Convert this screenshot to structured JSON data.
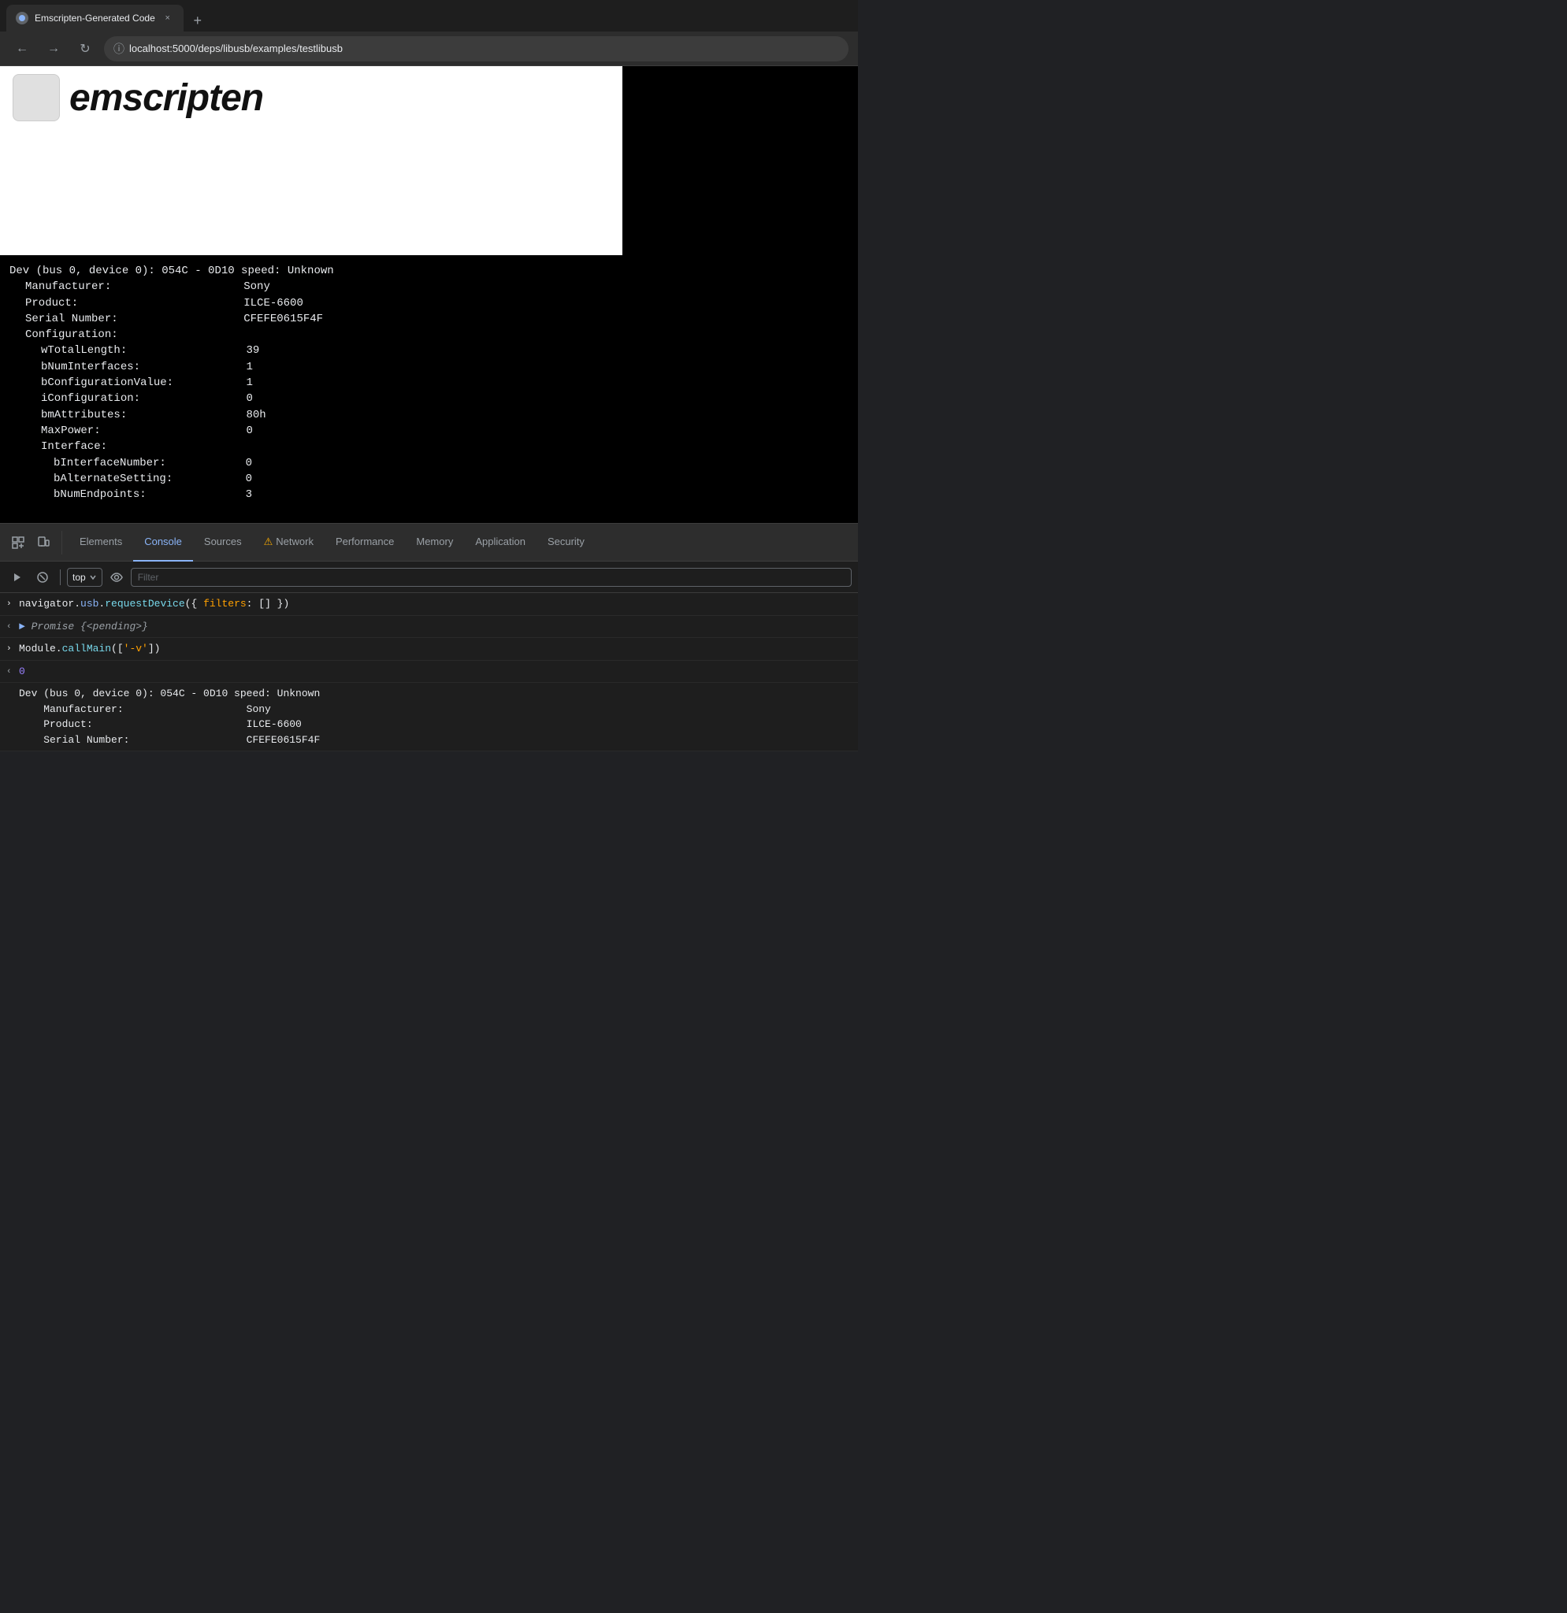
{
  "browser": {
    "tab_title": "Emscripten-Generated Code",
    "new_tab_label": "+",
    "close_label": "×",
    "url": "localhost:5000/deps/libusb/examples/testlibusb",
    "back_label": "←",
    "forward_label": "→",
    "reload_label": "↻"
  },
  "page": {
    "logo_text": "emscripten"
  },
  "terminal": {
    "lines": [
      "Dev (bus 0, device 0): 054C - 0D10 speed: Unknown",
      "  Manufacturer:                    Sony",
      "  Product:                         ILCE-6600",
      "  Serial Number:                   CFEFE0615F4F",
      "  Configuration:",
      "    wTotalLength:                  39",
      "    bNumInterfaces:                1",
      "    bConfigurationValue:           1",
      "    iConfiguration:                0",
      "    bmAttributes:                  80h",
      "    MaxPower:                      0",
      "    Interface:",
      "      bInterfaceNumber:            0",
      "      bAlternateSetting:           0",
      "      bNumEndpoints:               3"
    ]
  },
  "devtools": {
    "tabs": [
      {
        "id": "elements",
        "label": "Elements",
        "active": false,
        "warning": false
      },
      {
        "id": "console",
        "label": "Console",
        "active": true,
        "warning": false
      },
      {
        "id": "sources",
        "label": "Sources",
        "active": false,
        "warning": false
      },
      {
        "id": "network",
        "label": "Network",
        "active": false,
        "warning": true
      },
      {
        "id": "performance",
        "label": "Performance",
        "active": false,
        "warning": false
      },
      {
        "id": "memory",
        "label": "Memory",
        "active": false,
        "warning": false
      },
      {
        "id": "application",
        "label": "Application",
        "active": false,
        "warning": false
      },
      {
        "id": "security",
        "label": "Security",
        "active": false,
        "warning": false
      }
    ],
    "console_toolbar": {
      "top_label": "top",
      "filter_placeholder": "Filter",
      "chevron": "▾"
    },
    "console_entries": [
      {
        "id": "entry1",
        "direction": "input",
        "arrow": "›",
        "text_parts": [
          {
            "content": "navigator.",
            "color": "default"
          },
          {
            "content": "usb",
            "color": "blue"
          },
          {
            "content": ".",
            "color": "default"
          },
          {
            "content": "requestDevice",
            "color": "cyan"
          },
          {
            "content": "({ ",
            "color": "default"
          },
          {
            "content": "filters",
            "color": "orange"
          },
          {
            "content": ": [] })",
            "color": "default"
          }
        ]
      },
      {
        "id": "entry2",
        "direction": "output-left",
        "arrow": "‹",
        "text_parts": [
          {
            "content": "► ",
            "color": "blue"
          },
          {
            "content": "Promise {<pending>}",
            "color": "gray"
          }
        ]
      },
      {
        "id": "entry3",
        "direction": "input",
        "arrow": "›",
        "text_parts": [
          {
            "content": "Module.",
            "color": "default"
          },
          {
            "content": "callMain",
            "color": "cyan"
          },
          {
            "content": "([",
            "color": "default"
          },
          {
            "content": "'-v'",
            "color": "orange"
          },
          {
            "content": "])",
            "color": "default"
          }
        ]
      },
      {
        "id": "entry4",
        "direction": "output-left",
        "arrow": "‹",
        "text_parts": [
          {
            "content": "0",
            "color": "number"
          }
        ]
      }
    ],
    "console_device_output": {
      "header": "Dev (bus 0, device 0): 054C - 0D10 speed: Unknown",
      "lines": [
        "    Manufacturer:                    Sony",
        "    Product:                         ILCE-6600",
        "    Serial Number:                   CFEFE0615F4F"
      ]
    }
  }
}
